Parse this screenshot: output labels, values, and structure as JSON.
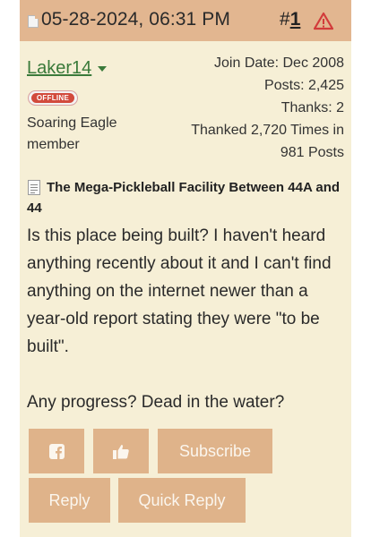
{
  "post": {
    "date": "05-28-2024, 06:31 PM",
    "number_prefix": "#",
    "number": "1",
    "title": "The Mega-Pickleball Facility Between 44A and 44",
    "body": "Is this place being built? I haven't heard anything recently about it and I can't find anything on the internet newer than a year-old report stating they were \"to be built\".\n\nAny progress? Dead in the water?"
  },
  "user": {
    "name": "Laker14",
    "status": "OFFLINE",
    "title": "Soaring Eagle member",
    "join_date": "Join Date: Dec 2008",
    "posts": "Posts: 2,425",
    "thanks": "Thanks: 2",
    "thanked_line1": "Thanked 2,720 Times in",
    "thanked_line2": "981 Posts"
  },
  "buttons": {
    "facebook_icon": "facebook-icon",
    "like_icon": "thumbs-up-icon",
    "subscribe": "Subscribe",
    "reply": "Reply",
    "quick_reply": "Quick Reply"
  },
  "colors": {
    "header_bg": "#e2b690",
    "post_bg": "#f6efd6",
    "button_bg": "#dfb38a",
    "username": "#3a7a3a",
    "offline": "#d24a3c"
  }
}
